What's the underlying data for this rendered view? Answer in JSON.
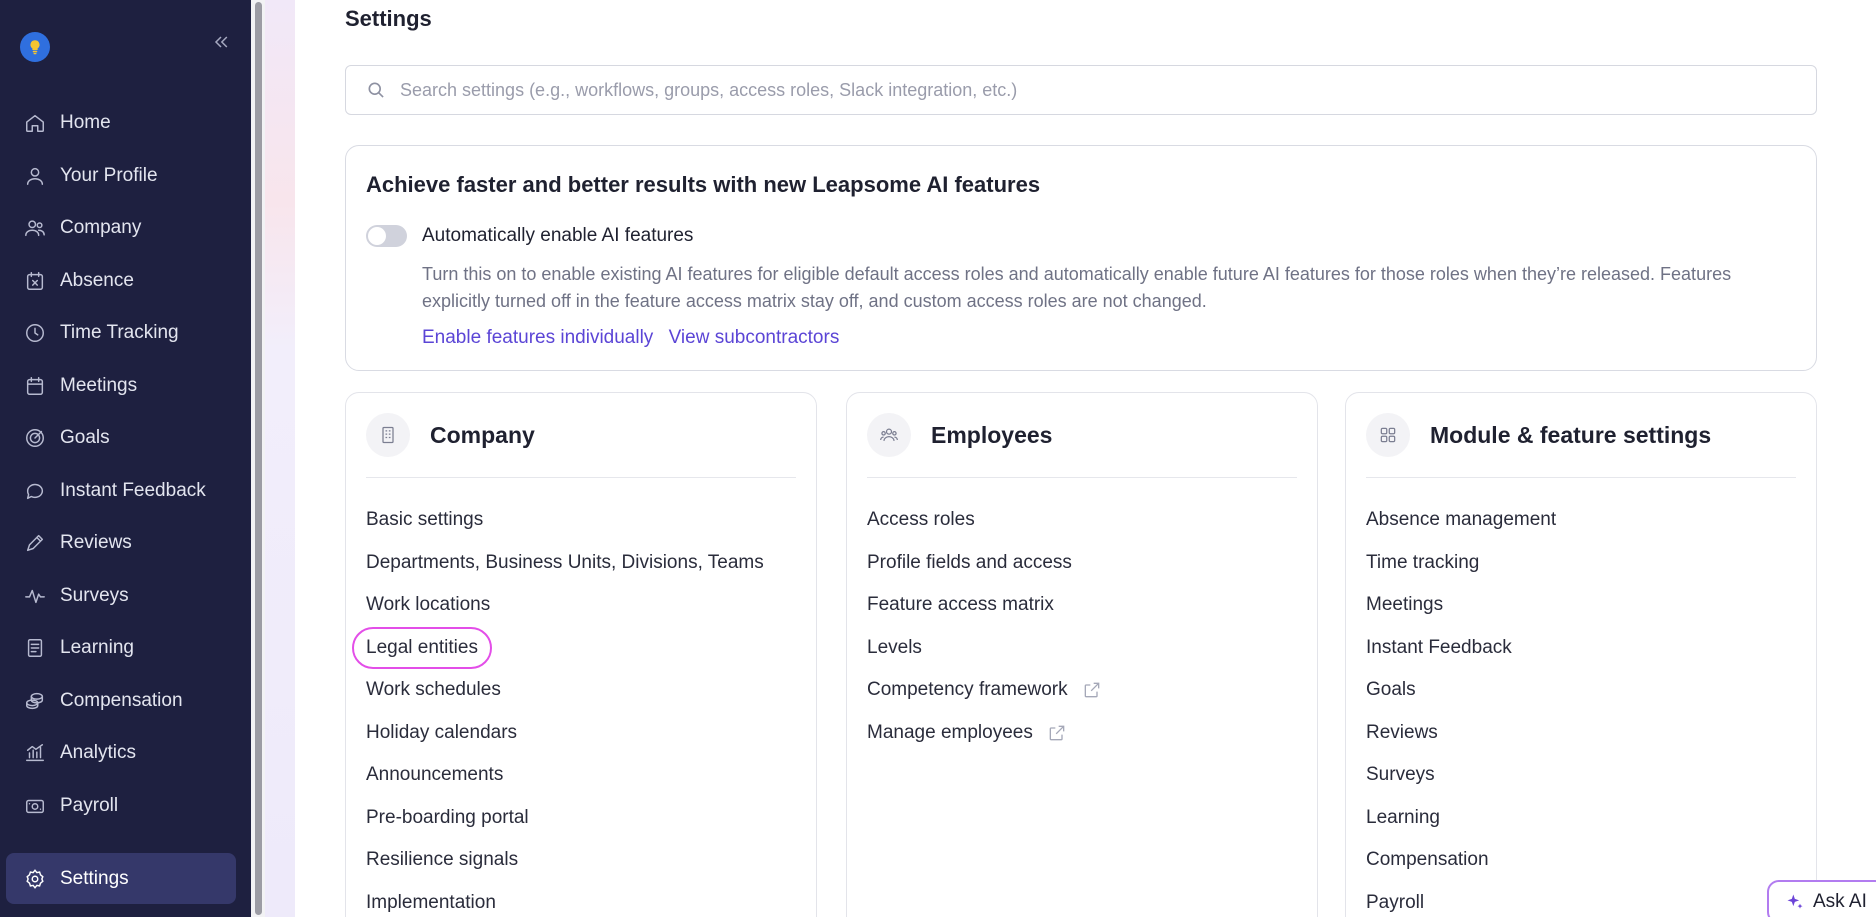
{
  "sidebar": {
    "items": [
      {
        "label": "Home",
        "icon": "home-icon"
      },
      {
        "label": "Your Profile",
        "icon": "user-icon"
      },
      {
        "label": "Company",
        "icon": "people-icon"
      },
      {
        "label": "Absence",
        "icon": "calendar-x-icon"
      },
      {
        "label": "Time Tracking",
        "icon": "clock-icon"
      },
      {
        "label": "Meetings",
        "icon": "calendar-icon"
      },
      {
        "label": "Goals",
        "icon": "target-icon"
      },
      {
        "label": "Instant Feedback",
        "icon": "chat-bubble-icon"
      },
      {
        "label": "Reviews",
        "icon": "pencil-icon"
      },
      {
        "label": "Surveys",
        "icon": "pulse-icon"
      },
      {
        "label": "Learning",
        "icon": "book-icon"
      },
      {
        "label": "Compensation",
        "icon": "coins-icon"
      },
      {
        "label": "Analytics",
        "icon": "chart-icon"
      },
      {
        "label": "Payroll",
        "icon": "money-icon"
      }
    ],
    "active": {
      "label": "Settings",
      "icon": "gear-icon"
    }
  },
  "main": {
    "title": "Settings",
    "search_placeholder": "Search settings (e.g., workflows, groups, access roles, Slack integration, etc.)"
  },
  "ai_card": {
    "title": "Achieve faster and better results with new Leapsome AI features",
    "toggle_label": "Automatically enable AI features",
    "description": "Turn this on to enable existing AI features for eligible default access roles and automatically enable future AI features for those roles when they’re released. Features explicitly turned off in the feature access matrix stay off, and custom access roles are not changed.",
    "link1": "Enable features individually",
    "link2": "View subcontractors"
  },
  "columns": {
    "company": {
      "title": "Company",
      "items": [
        "Basic settings",
        "Departments, Business Units, Divisions, Teams",
        "Work locations",
        "Legal entities",
        "Work schedules",
        "Holiday calendars",
        "Announcements",
        "Pre-boarding portal",
        "Resilience signals",
        "Implementation"
      ]
    },
    "employees": {
      "title": "Employees",
      "items": [
        "Access roles",
        "Profile fields and access",
        "Feature access matrix",
        "Levels",
        "Competency framework",
        "Manage employees"
      ]
    },
    "modules": {
      "title": "Module & feature settings",
      "items": [
        "Absence management",
        "Time tracking",
        "Meetings",
        "Instant Feedback",
        "Goals",
        "Reviews",
        "Surveys",
        "Learning",
        "Compensation",
        "Payroll"
      ]
    }
  },
  "ask_ai": {
    "label": "Ask AI"
  }
}
